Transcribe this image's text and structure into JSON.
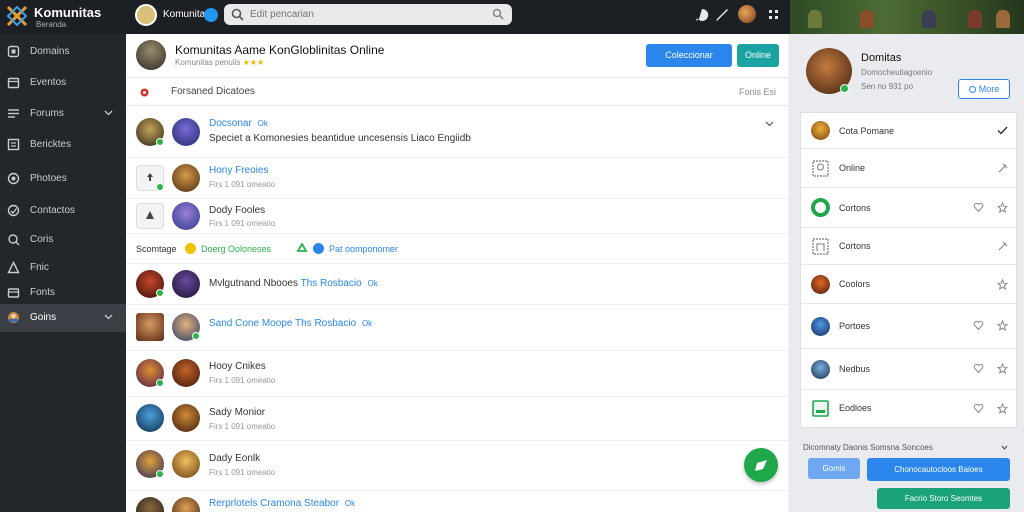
{
  "topbar": {
    "app_name": "Komunitas",
    "app_sub": "Beranda",
    "user_name": "Komunitas",
    "search_placeholder": "Edit pencarian",
    "icons": [
      "search-icon",
      "flag-icon",
      "bell-icon",
      "grid-icon"
    ]
  },
  "sidebar": {
    "items": [
      {
        "label": "Domains",
        "icon": "home-icon"
      },
      {
        "label": "Eventos",
        "icon": "calendar-icon"
      },
      {
        "label": "Forums",
        "icon": "forum-icon",
        "chevron": true
      },
      {
        "label": "Bericktes",
        "icon": "news-icon"
      },
      {
        "label": "Photoes",
        "icon": "photo-icon"
      },
      {
        "label": "Contactos",
        "icon": "contacts-icon"
      },
      {
        "label": "Coris",
        "icon": "chat-icon"
      },
      {
        "label": "Fnic",
        "icon": "trophy-icon"
      },
      {
        "label": "Fonts",
        "icon": "wallet-icon"
      },
      {
        "label": "Goins",
        "icon": "game-icon",
        "chevron": true,
        "active": true
      }
    ]
  },
  "main": {
    "title": "Komunitas Aame KonGloblinitas Online",
    "subtitle": "Komunitas penulis",
    "stars": "★★★",
    "btn_primary": "Coleccionar",
    "btn_teal": "Online",
    "filter_label": "Forsaned Dicatoes",
    "filter_right": "Fonis Esi",
    "rows": [
      {
        "type": "message",
        "name": "Docsonar",
        "badge": "Ok",
        "message": "Speciet a Komonesies beantidue uncesensis Liaco Engiidb"
      },
      {
        "type": "small",
        "name": "Hony Freoies",
        "meta": "Firs 1 091 omeatio"
      },
      {
        "type": "small",
        "name": "Dody Fooles",
        "meta": "Firs 1 091 omeatio"
      },
      {
        "type": "highlight",
        "name": "Mvlgutnand Nbooes",
        "extra": "Ths Rosbacio",
        "badge": "Ok"
      },
      {
        "type": "highlight",
        "name": "Sand Cone Moope",
        "extra": "Ths Rosbacio",
        "badge": "Ok",
        "name_blue": true
      },
      {
        "type": "small",
        "name": "Hooy Cnikes",
        "meta": "Firs 1 091 omeatio"
      },
      {
        "type": "small",
        "name": "Sady Monior",
        "meta": "Firs 1 091 omeatio"
      },
      {
        "type": "small",
        "name": "Dady Eonlk",
        "meta": "Firs 1 091 omeatio"
      },
      {
        "type": "highlight",
        "name": "Rerprlotels Cramona Steabor",
        "badge": "Ok",
        "name_blue": true
      }
    ],
    "section": {
      "label": "Scomtage",
      "mid": "Doerg Ooloneses",
      "right": "Pat oomponomer"
    }
  },
  "right": {
    "name": "Domitas",
    "sub": "Domocheutiagoenio",
    "meta": "Sen no 931 po",
    "more_label": "More",
    "items": [
      {
        "label": "Cota Pomane",
        "action": "check-icon"
      },
      {
        "label": "Online",
        "action": "pin-icon"
      },
      {
        "label": "Cortons",
        "action": "heart-icon",
        "action2": "star-icon"
      },
      {
        "label": "Cortons",
        "action": "pin-icon"
      },
      {
        "label": "Coolors",
        "action": "star-icon"
      },
      {
        "label": "Portoes",
        "action": "heart-icon",
        "action2": "star-icon"
      },
      {
        "label": "Nedbus",
        "action": "heart-icon",
        "action2": "star-icon"
      },
      {
        "label": "Eodloes",
        "action": "heart-icon",
        "action2": "star-icon"
      }
    ],
    "footer_label": "Dicomnaty Daonis Somsna Soncoes",
    "btn_small": "Gomis",
    "btn_wide": "Chonocautocloos Baioes",
    "btn_green": "Facrio Storo  Seomtes"
  },
  "colors": {
    "accent": "#2a86ea",
    "teal": "#1aa3a3",
    "green": "#1fa84b",
    "sidebar_bg": "#23272c"
  }
}
